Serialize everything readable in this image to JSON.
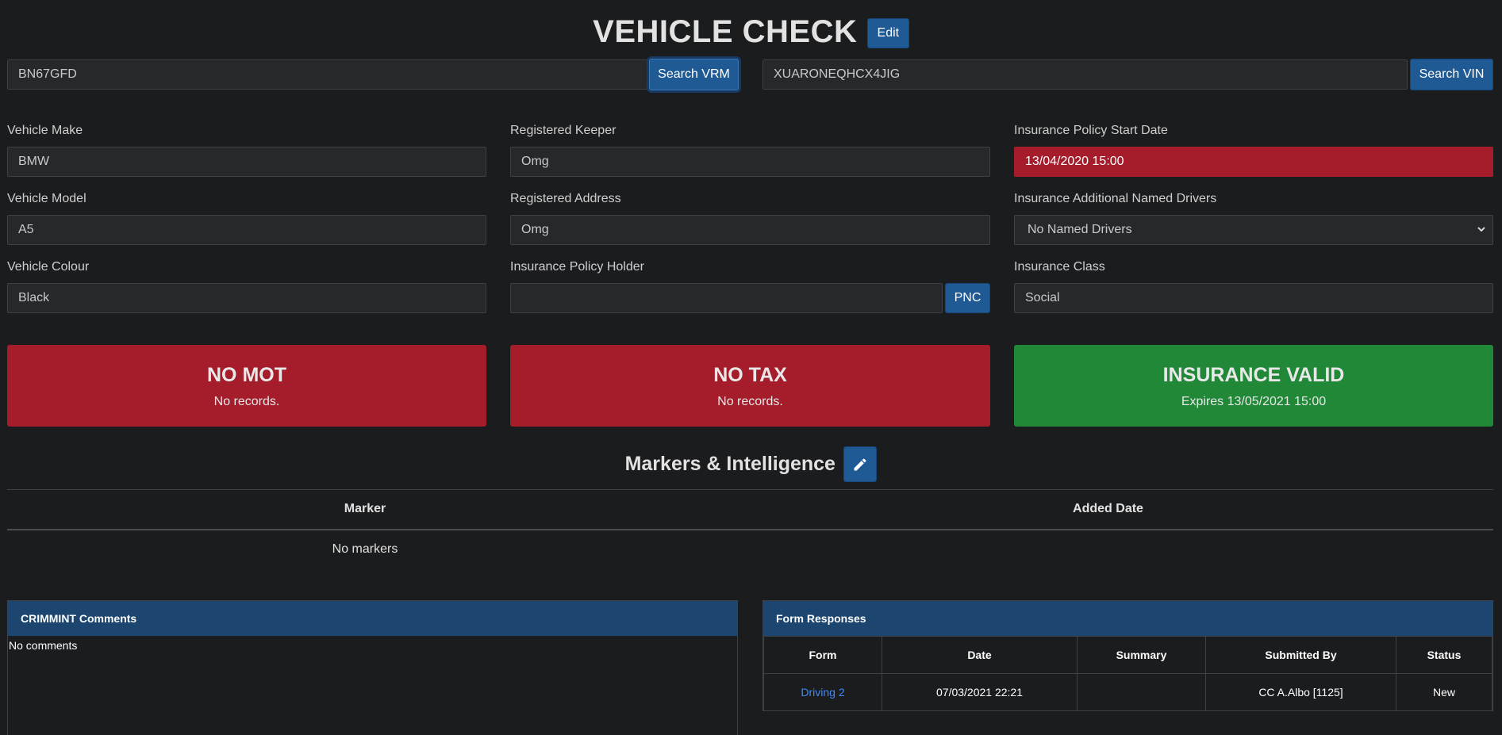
{
  "header": {
    "title": "VEHICLE CHECK",
    "edit_label": "Edit"
  },
  "search": {
    "vrm_value": "BN67GFD",
    "vrm_button": "Search VRM",
    "vin_value": "XUARONEQHCX4JIG",
    "vin_button": "Search VIN"
  },
  "fields": {
    "vehicle_make": {
      "label": "Vehicle Make",
      "value": "BMW"
    },
    "vehicle_model": {
      "label": "Vehicle Model",
      "value": "A5"
    },
    "vehicle_colour": {
      "label": "Vehicle Colour",
      "value": "Black"
    },
    "registered_keeper": {
      "label": "Registered Keeper",
      "value": "Omg"
    },
    "registered_address": {
      "label": "Registered Address",
      "value": "Omg"
    },
    "insurance_policy_holder": {
      "label": "Insurance Policy Holder",
      "value": "",
      "button": "PNC"
    },
    "insurance_start_date": {
      "label": "Insurance Policy Start Date",
      "value": "13/04/2020 15:00"
    },
    "insurance_named_drivers": {
      "label": "Insurance Additional Named Drivers",
      "value": "No Named Drivers"
    },
    "insurance_class": {
      "label": "Insurance Class",
      "value": "Social"
    }
  },
  "status": {
    "mot": {
      "title": "NO MOT",
      "subtitle": "No records.",
      "color": "#a51c2b"
    },
    "tax": {
      "title": "NO TAX",
      "subtitle": "No records.",
      "color": "#a51c2b"
    },
    "insurance": {
      "title": "INSURANCE VALID",
      "subtitle": "Expires 13/05/2021 15:00",
      "color": "#218838"
    }
  },
  "markers": {
    "title": "Markers & Intelligence",
    "columns": [
      "Marker",
      "Added Date"
    ],
    "empty_text": "No markers"
  },
  "crimmint": {
    "title": "CRIMMINT Comments",
    "empty_text": "No comments"
  },
  "form_responses": {
    "title": "Form Responses",
    "columns": [
      "Form",
      "Date",
      "Summary",
      "Submitted By",
      "Status"
    ],
    "rows": [
      {
        "form": "Driving 2",
        "date": "07/03/2021 22:21",
        "summary": "",
        "submitted_by": "CC A.Albo [1125]",
        "status": "New"
      }
    ]
  }
}
